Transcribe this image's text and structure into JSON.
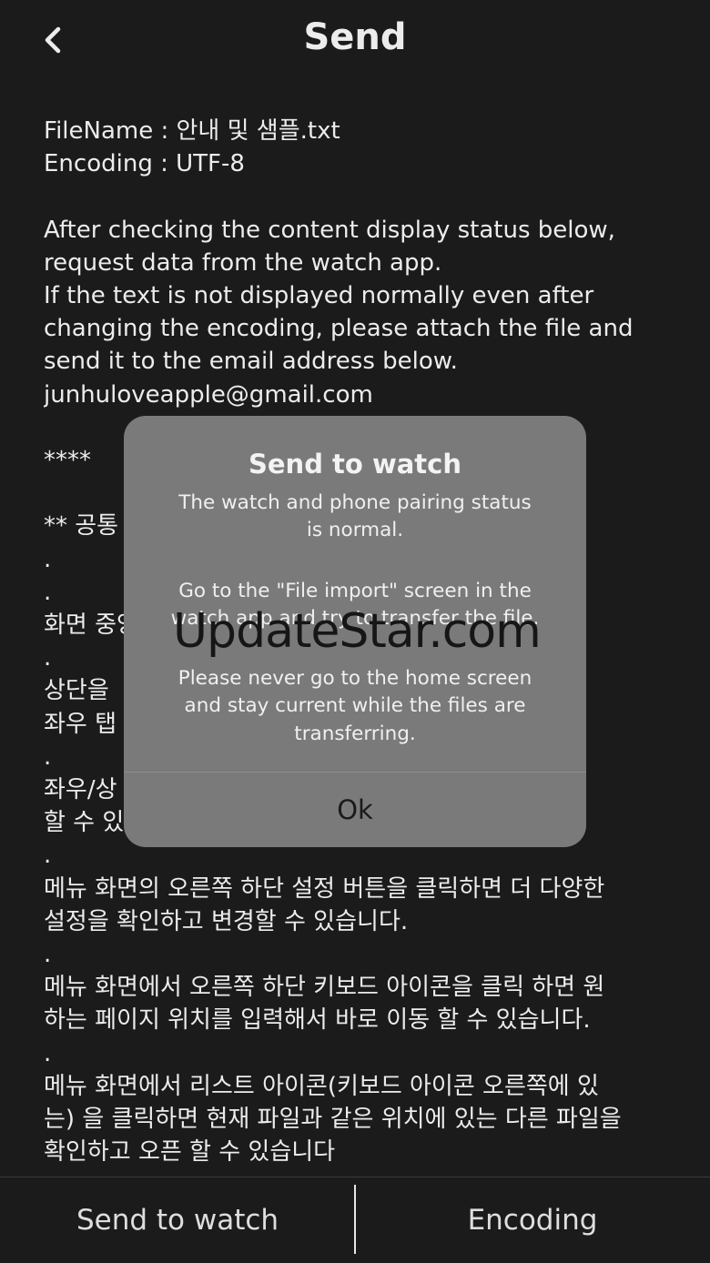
{
  "nav": {
    "title": "Send",
    "back_icon": "chevron-left-icon"
  },
  "content": {
    "lines": [
      "FileName : 안내 및 샘플.txt",
      "Encoding : UTF-8",
      "",
      "After checking the content display status below,",
      "request data from the watch app.",
      "If the text is not displayed normally even after",
      "changing the encoding, please attach the file and",
      "send it to the email address below.",
      "junhuloveapple@gmail.com",
      "",
      "****",
      "",
      "** 공통",
      ".",
      ".",
      "화면 중앙",
      ".",
      "상단을",
      "좌우 탭",
      ".",
      "좌우/상                                               서 변경",
      "할 수 있",
      ".",
      "메뉴 화면의 오른쪽 하단 설정 버튼을 클릭하면 더 다양한",
      "설정을 확인하고 변경할 수 있습니다.",
      ".",
      "메뉴 화면에서 오른쪽 하단 키보드 아이콘을 클릭 하면 원",
      "하는 페이지 위치를 입력해서 바로 이동 할 수 있습니다.",
      ".",
      "메뉴 화면에서 리스트 아이콘(키보드 아이콘 오른쪽에 있",
      "는) 을 클릭하면 현재 파일과 같은 위치에 있는 다른 파일을",
      "확인하고 오픈 할 수 있습니다"
    ]
  },
  "alert": {
    "title": "Send to watch",
    "message_lines": [
      "The watch and phone pairing status",
      "is normal.",
      "",
      "Go to the \"File import\" screen in the",
      "watch app and try to transfer the file.",
      "",
      "Please never go to the home screen",
      "and stay current while the files are",
      "transferring."
    ],
    "ok_label": "Ok"
  },
  "watermark": "UpdateStar.com",
  "bottom_bar": {
    "send_label": "Send to watch",
    "encoding_label": "Encoding"
  }
}
